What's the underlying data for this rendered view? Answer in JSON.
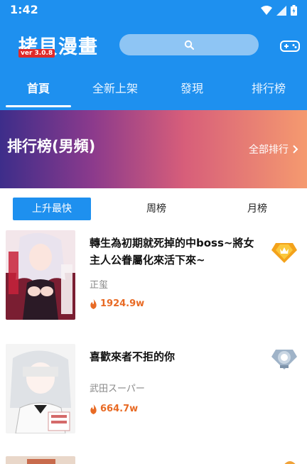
{
  "status_bar": {
    "time": "1:42"
  },
  "app": {
    "logo_text": "拷貝漫畫",
    "version": "ver 3.0.8"
  },
  "tabs": [
    {
      "label": "首頁",
      "active": true
    },
    {
      "label": "全新上架",
      "active": false
    },
    {
      "label": "發現",
      "active": false
    },
    {
      "label": "排行榜",
      "active": false
    }
  ],
  "banner": {
    "title": "排行榜(男頻)",
    "all_label": "全部排行"
  },
  "subtabs": [
    {
      "label": "上升最快",
      "active": true
    },
    {
      "label": "周榜",
      "active": false
    },
    {
      "label": "月榜",
      "active": false
    }
  ],
  "items": [
    {
      "title": "轉生為初期就死掉的中boss~將女主人公眷屬化來活下來~",
      "author": "正玺",
      "heat": "1924.9w",
      "rank_badge": "gold-crown-icon"
    },
    {
      "title": "喜歡來者不拒的你",
      "author": "武田スーパー",
      "heat": "664.7w",
      "rank_badge": "silver-medal-icon"
    }
  ],
  "colors": {
    "primary": "#1e90ef",
    "heat": "#e86a24"
  }
}
